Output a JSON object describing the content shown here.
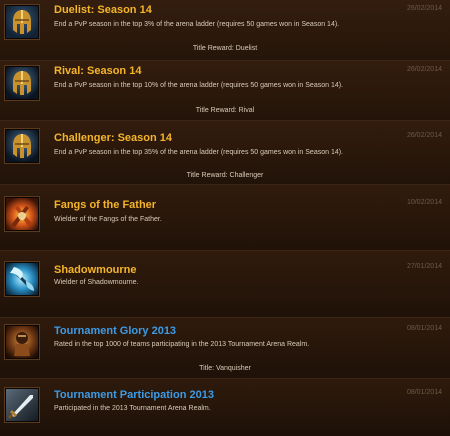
{
  "achievements": [
    {
      "title": "Duelist: Season 14",
      "description": "End a PvP season in the top 3% of the arena ladder (requires 50 games won in Season 14).",
      "date": "26/02/2014",
      "reward": "Title Reward: Duelist",
      "title_color": "#f5b52a",
      "icon": "gladiator-helm-icon"
    },
    {
      "title": "Rival: Season 14",
      "description": "End a PvP season in the top 10% of the arena ladder (requires 50 games won in Season 14).",
      "date": "26/02/2014",
      "reward": "Title Reward: Rival",
      "title_color": "#f5b52a",
      "icon": "gladiator-helm-icon"
    },
    {
      "title": "Challenger: Season 14",
      "description": "End a PvP season in the top 35% of the arena ladder (requires 50 games won in Season 14).",
      "date": "26/02/2014",
      "reward": "Title Reward: Challenger",
      "title_color": "#f5b52a",
      "icon": "gladiator-helm-icon"
    },
    {
      "title": "Fangs of the Father",
      "description": "Wielder of the Fangs of the Father.",
      "date": "10/02/2014",
      "reward": "",
      "title_color": "#f5b52a",
      "icon": "fire-daggers-icon"
    },
    {
      "title": "Shadowmourne",
      "description": "Wielder of Shadowmourne.",
      "date": "27/01/2014",
      "reward": "",
      "title_color": "#f5b52a",
      "icon": "frost-axe-icon"
    },
    {
      "title": "Tournament Glory 2013",
      "description": "Rated in the top 1000 of teams participating in the 2013 Tournament Arena Realm.",
      "date": "08/01/2014",
      "reward": "Title: Vanquisher",
      "title_color": "#3d9be6",
      "icon": "tournament-warrior-icon"
    },
    {
      "title": "Tournament Participation 2013",
      "description": "Participated in the 2013 Tournament Arena Realm.",
      "date": "08/01/2014",
      "reward": "",
      "title_color": "#3d9be6",
      "icon": "tournament-sword-icon"
    }
  ]
}
